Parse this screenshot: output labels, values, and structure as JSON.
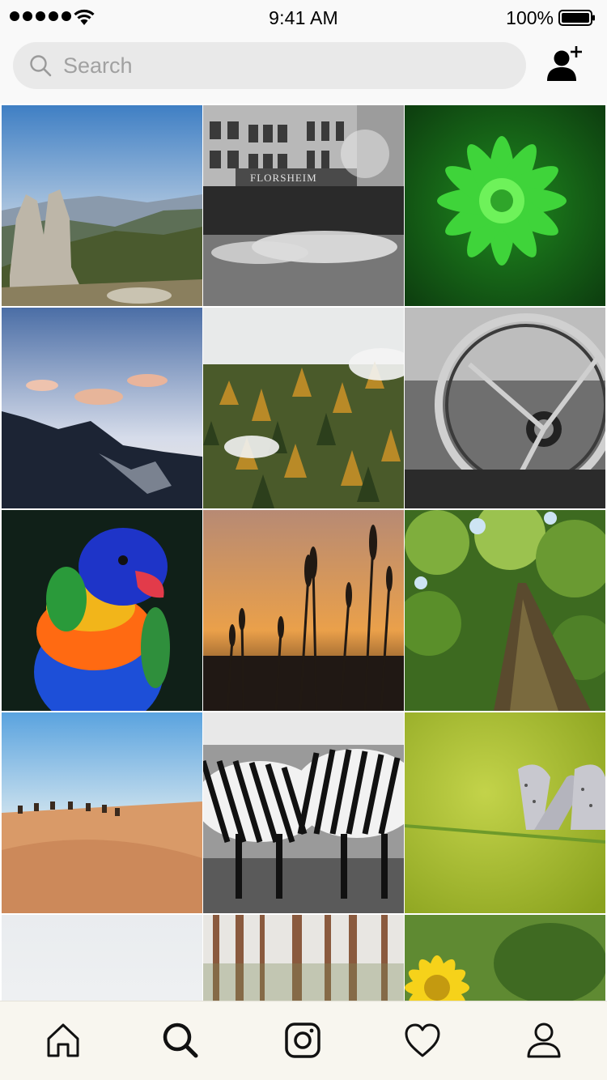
{
  "status_bar": {
    "time": "9:41 AM",
    "battery_percent": "100%",
    "signal_bars": 5
  },
  "search": {
    "placeholder": "Search",
    "value": ""
  },
  "header_icons": {
    "add_user": "add-user-icon"
  },
  "explore_grid": {
    "tiles": [
      {
        "subject": "mountain-rock-peaks"
      },
      {
        "subject": "city-street-florsheim"
      },
      {
        "subject": "green-plant-rosette"
      },
      {
        "subject": "mountain-sunset-sky"
      },
      {
        "subject": "foggy-autumn-forest"
      },
      {
        "subject": "vintage-steering-wheel"
      },
      {
        "subject": "rainbow-lorikeet"
      },
      {
        "subject": "wheat-sunset-silhouette"
      },
      {
        "subject": "tall-tree-from-below"
      },
      {
        "subject": "desert-camel-caravan"
      },
      {
        "subject": "zebras-fighting"
      },
      {
        "subject": "butterflies-on-grass"
      },
      {
        "subject": "cloudy-sky"
      },
      {
        "subject": "pine-forest-trunks"
      },
      {
        "subject": "yellow-flower"
      }
    ],
    "storefront_sign": "FLORSHEIM"
  },
  "tab_bar": {
    "tabs": [
      {
        "icon": "home-icon",
        "selected": false
      },
      {
        "icon": "search-icon",
        "selected": true
      },
      {
        "icon": "camera-icon",
        "selected": false
      },
      {
        "icon": "heart-icon",
        "selected": false
      },
      {
        "icon": "profile-icon",
        "selected": false
      }
    ]
  },
  "colors": {
    "bar_background": "#f9f9f9",
    "search_field": "#e9e9e9",
    "placeholder_text": "#a1a1a1",
    "icon": "#111111"
  }
}
